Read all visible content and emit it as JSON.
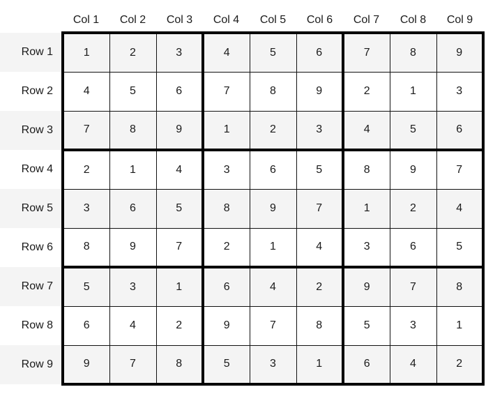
{
  "columns": [
    "Col 1",
    "Col 2",
    "Col 3",
    "Col 4",
    "Col 5",
    "Col 6",
    "Col 7",
    "Col 8",
    "Col 9"
  ],
  "rows": [
    {
      "label": "Row 1",
      "values": [
        "1",
        "2",
        "3",
        "4",
        "5",
        "6",
        "7",
        "8",
        "9"
      ]
    },
    {
      "label": "Row 2",
      "values": [
        "4",
        "5",
        "6",
        "7",
        "8",
        "9",
        "2",
        "1",
        "3"
      ]
    },
    {
      "label": "Row 3",
      "values": [
        "7",
        "8",
        "9",
        "1",
        "2",
        "3",
        "4",
        "5",
        "6"
      ]
    },
    {
      "label": "Row 4",
      "values": [
        "2",
        "1",
        "4",
        "3",
        "6",
        "5",
        "8",
        "9",
        "7"
      ]
    },
    {
      "label": "Row 5",
      "values": [
        "3",
        "6",
        "5",
        "8",
        "9",
        "7",
        "1",
        "2",
        "4"
      ]
    },
    {
      "label": "Row 6",
      "values": [
        "8",
        "9",
        "7",
        "2",
        "1",
        "4",
        "3",
        "6",
        "5"
      ]
    },
    {
      "label": "Row 7",
      "values": [
        "5",
        "3",
        "1",
        "6",
        "4",
        "2",
        "9",
        "7",
        "8"
      ]
    },
    {
      "label": "Row 8",
      "values": [
        "6",
        "4",
        "2",
        "9",
        "7",
        "8",
        "5",
        "3",
        "1"
      ]
    },
    {
      "label": "Row 9",
      "values": [
        "9",
        "7",
        "8",
        "5",
        "3",
        "1",
        "6",
        "4",
        "2"
      ]
    }
  ],
  "colors": {
    "stripe": "#f4f4f4",
    "grid_line": "#000000"
  }
}
